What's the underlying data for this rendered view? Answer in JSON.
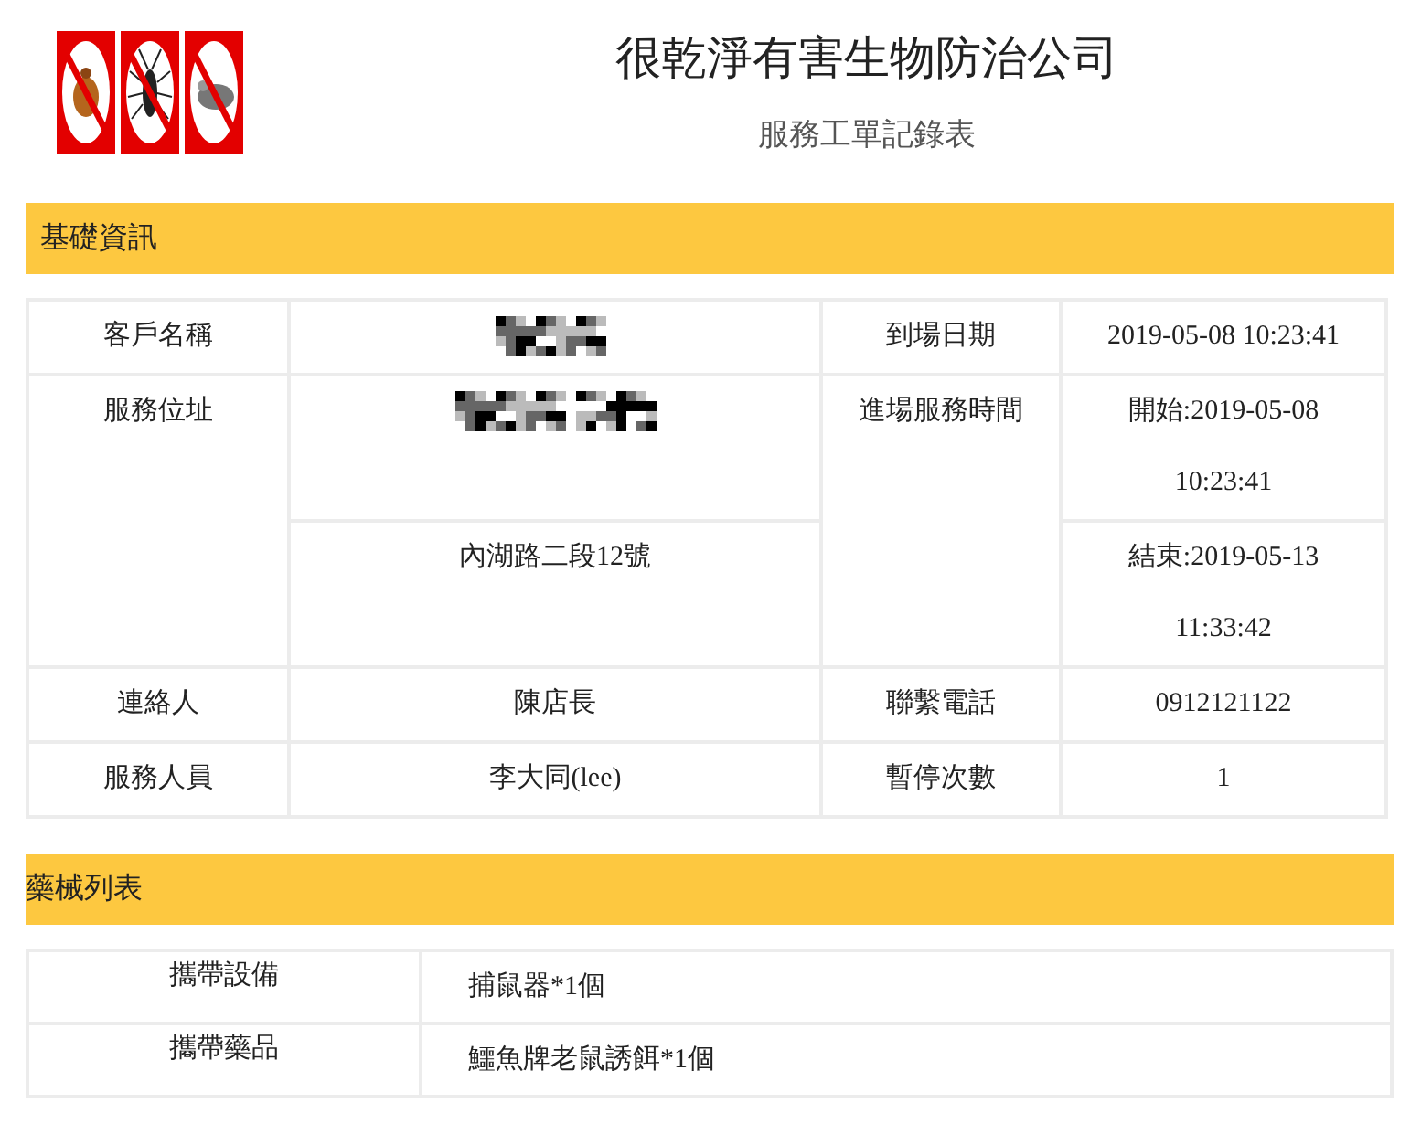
{
  "header": {
    "company": "很乾淨有害生物防治公司",
    "form_title": "服務工單記錄表"
  },
  "basic_info": {
    "title": "基礎資訊",
    "customer_label": "客戶名稱",
    "arrival_label": "到場日期",
    "arrival_value": "2019-05-08 10:23:41",
    "address_label": "服務位址",
    "address_value": "內湖路二段12號",
    "service_time_label": "進場服務時間",
    "start": "開始:2019-05-08 10:23:41",
    "end": "結束:2019-05-13 11:33:42",
    "contact_label": "連絡人",
    "contact_value": "陳店長",
    "phone_label": "聯繫電話",
    "phone_value": "0912121122",
    "staff_label": "服務人員",
    "staff_value": "李大同(lee)",
    "pause_label": "暫停次數",
    "pause_value": "1"
  },
  "supplies": {
    "title": "藥械列表",
    "rows": [
      {
        "label": "攜帶設備",
        "value": "捕鼠器*1個"
      },
      {
        "label": "攜帶藥品",
        "value": "鱷魚牌老鼠誘餌*1個"
      }
    ]
  }
}
